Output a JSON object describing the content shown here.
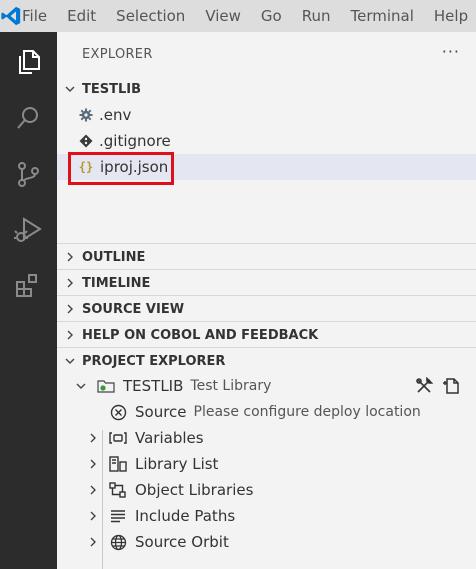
{
  "menu": {
    "items": [
      "File",
      "Edit",
      "Selection",
      "View",
      "Go",
      "Run",
      "Terminal",
      "Help"
    ]
  },
  "explorer": {
    "title": "EXPLORER",
    "more": "···",
    "workspace": "TESTLIB",
    "files": [
      {
        "name": ".env",
        "icon": "gear-icon"
      },
      {
        "name": ".gitignore",
        "icon": "git-diamond-icon"
      },
      {
        "name": "iproj.json",
        "icon": "json-braces-icon",
        "selected": true
      }
    ]
  },
  "sections": {
    "outline": "OUTLINE",
    "timeline": "TIMELINE",
    "source_view": "SOURCE VIEW",
    "help": "HELP ON COBOL AND FEEDBACK",
    "project_explorer": "PROJECT EXPLORER"
  },
  "project": {
    "name": "TESTLIB",
    "description": "Test Library",
    "children": [
      {
        "label": "Source",
        "detail": "Please configure deploy location",
        "icon": "error-circle-icon"
      },
      {
        "label": "Variables",
        "icon": "variable-icon"
      },
      {
        "label": "Library List",
        "icon": "library-list-icon"
      },
      {
        "label": "Object Libraries",
        "icon": "object-libraries-icon"
      },
      {
        "label": "Include Paths",
        "icon": "list-icon"
      },
      {
        "label": "Source Orbit",
        "icon": "globe-icon"
      }
    ]
  },
  "colors": {
    "activity_bar": "#2c2c2c",
    "menu_bar": "#dddddd",
    "sidebar": "#f3f3f3",
    "selection": "#e4e6f1",
    "highlight": "#e0101a",
    "vscode_blue": "#0078d4"
  }
}
